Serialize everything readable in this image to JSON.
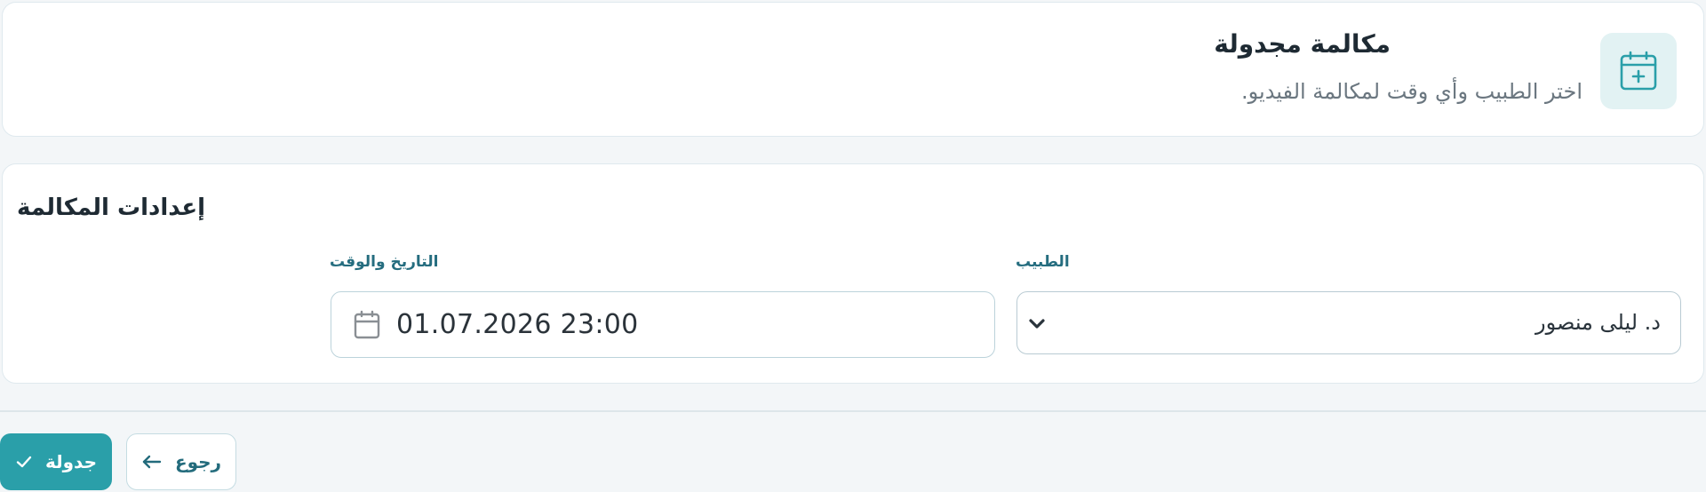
{
  "header": {
    "title": "مكالمة مجدولة",
    "subtitle": "اختر الطبيب وأي وقت لمكالمة الفيديو.",
    "icon": "calendar-plus-icon"
  },
  "settings": {
    "title": "إعدادات المكالمة",
    "doctor": {
      "label": "الطبيب",
      "selected": "د. ليلى منصور"
    },
    "datetime": {
      "label": "التاريخ والوقت",
      "value": "01.07.2026 23:00"
    }
  },
  "actions": {
    "schedule_label": "جدولة",
    "back_label": "رجوع"
  },
  "colors": {
    "accent": "#2a9fa9",
    "accent_text": "#236b7c",
    "icon_bg": "#e2f2f3",
    "page_bg": "#f3f6f8"
  }
}
